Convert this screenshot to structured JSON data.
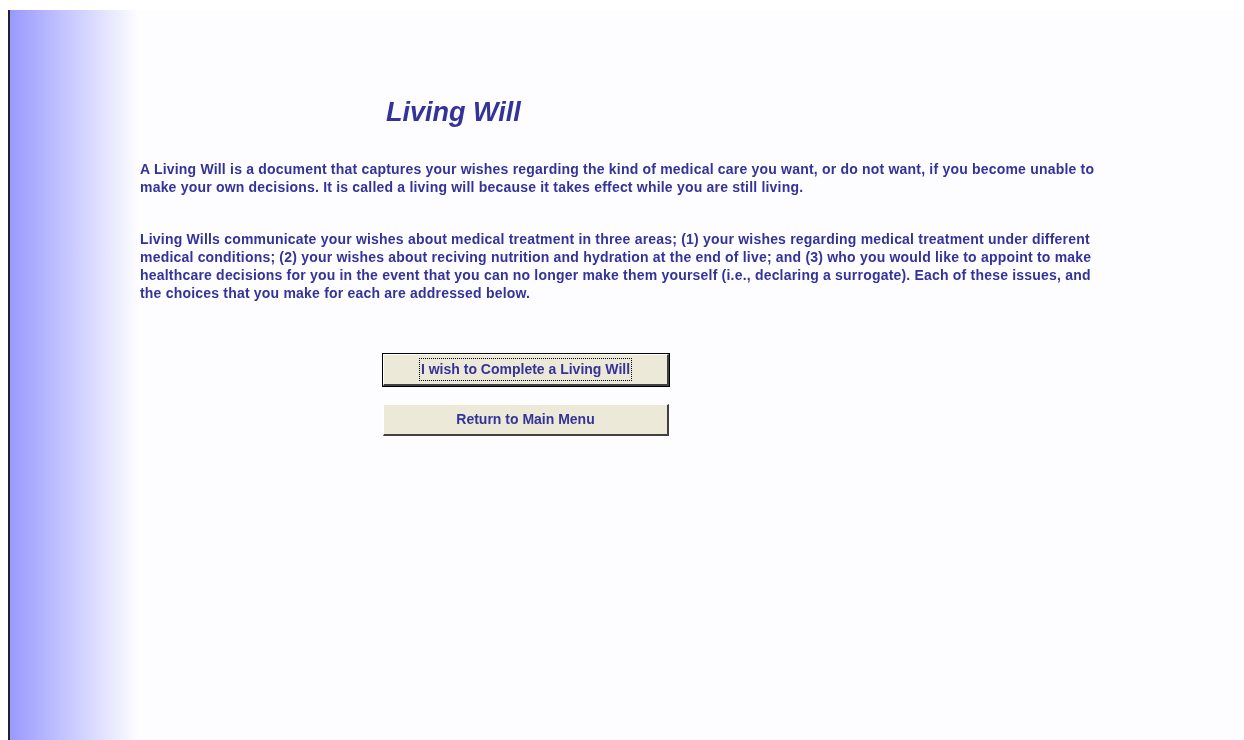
{
  "title": "Living Will",
  "paragraphs": [
    "A Living Will is a document that captures your wishes regarding the kind of medical care you want, or do not want, if you become unable to make your own decisions.  It is called a living will because it takes effect while you are still living.",
    "Living Wills communicate your wishes about medical treatment in three areas; (1) your wishes regarding medical treatment under  different medical conditions; (2) your wishes about reciving nutrition and hydration at the end of live; and (3) who you would like to appoint to make healthcare decisions for you in the event that you can no longer make them yourself (i.e., declaring a surrogate).  Each of these issues, and the choices that you make for each are addressed below."
  ],
  "buttons": [
    {
      "label": "I wish to Complete a Living Will",
      "focused": true
    },
    {
      "label": "Return to Main Menu",
      "focused": false
    }
  ]
}
